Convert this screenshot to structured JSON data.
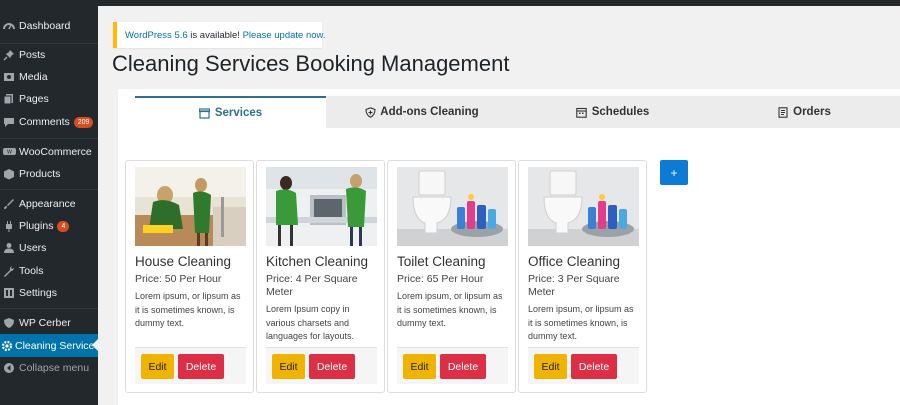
{
  "sidebar": {
    "items": [
      {
        "label": "Dashboard",
        "icon": "dashboard-icon"
      },
      {
        "label": "Posts",
        "icon": "pin-icon"
      },
      {
        "label": "Media",
        "icon": "media-icon"
      },
      {
        "label": "Pages",
        "icon": "pages-icon"
      },
      {
        "label": "Comments",
        "icon": "comments-icon",
        "badge": "209"
      },
      {
        "label": "WooCommerce",
        "icon": "woocommerce-icon"
      },
      {
        "label": "Products",
        "icon": "products-icon"
      },
      {
        "label": "Appearance",
        "icon": "brush-icon"
      },
      {
        "label": "Plugins",
        "icon": "plugin-icon",
        "badge": "4"
      },
      {
        "label": "Users",
        "icon": "users-icon"
      },
      {
        "label": "Tools",
        "icon": "wrench-icon"
      },
      {
        "label": "Settings",
        "icon": "settings-icon"
      },
      {
        "label": "WP Cerber",
        "icon": "shield-icon"
      },
      {
        "label": "Cleaning Services",
        "icon": "gear-icon",
        "active": true
      },
      {
        "label": "Collapse menu",
        "icon": "collapse-icon"
      }
    ]
  },
  "notice": {
    "version_link": "WordPress 5.6",
    "text": " is available! ",
    "update_link": "Please update now."
  },
  "page": {
    "title": "Cleaning Services Booking Management"
  },
  "tabs": [
    {
      "label": "Services",
      "icon": "services-icon",
      "active": true
    },
    {
      "label": "Add-ons Cleaning",
      "icon": "shield-plus-icon"
    },
    {
      "label": "Schedules",
      "icon": "calendar-icon"
    },
    {
      "label": "Orders",
      "icon": "document-icon"
    }
  ],
  "add_button": {
    "label": "+"
  },
  "services": [
    {
      "name": "House Cleaning",
      "price": "Price: 50 Per Hour",
      "description": "Lorem ipsum, or lipsum as it is sometimes known, is dummy text.",
      "image": "cleaners-photo"
    },
    {
      "name": "Kitchen Cleaning",
      "price": "Price: 4 Per Square Meter",
      "description": "Lorem Ipsum copy in various charsets and languages for layouts.",
      "image": "kitchen-cleaners-photo"
    },
    {
      "name": "Toilet Cleaning",
      "price": "Price: 65 Per Hour",
      "description": "Lorem ipsum, or lipsum as it is sometimes known, is dummy text.",
      "image": "toilet-supplies-photo"
    },
    {
      "name": "Office Cleaning",
      "price": "Price: 3 Per Square Meter",
      "description": "Lorem ipsum, or lipsum as it is sometimes known, is dummy text.",
      "image": "toilet-supplies-photo"
    }
  ],
  "card_actions": {
    "edit": "Edit",
    "delete": "Delete"
  },
  "colors": {
    "sidebar": "#23282d",
    "active": "#0073aa",
    "edit": "#f0b400",
    "delete": "#dc2f45",
    "add": "#0d7bd5"
  }
}
